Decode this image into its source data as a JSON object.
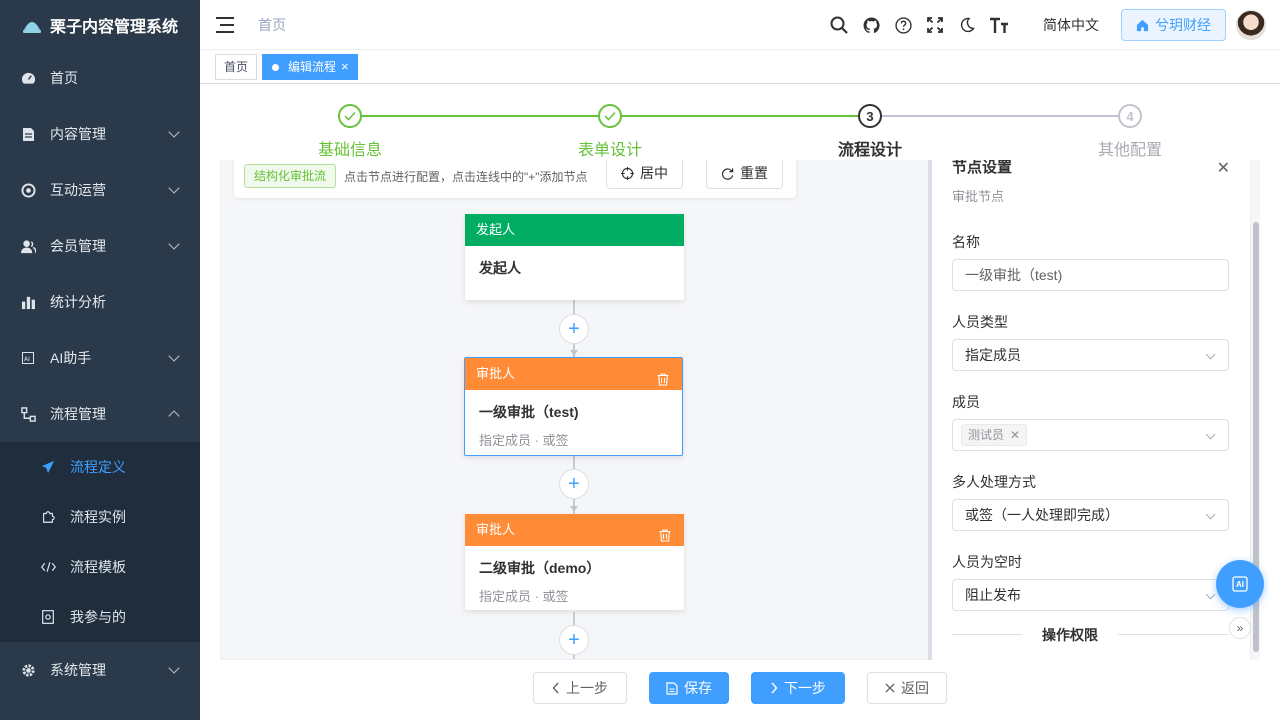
{
  "app": {
    "title": "栗子内容管理系统"
  },
  "sidebar": {
    "items": [
      {
        "label": "首页",
        "icon": "dashboard-icon"
      },
      {
        "label": "内容管理",
        "icon": "document-icon"
      },
      {
        "label": "互动运营",
        "icon": "target-icon"
      },
      {
        "label": "会员管理",
        "icon": "user-icon"
      },
      {
        "label": "统计分析",
        "icon": "bar-chart-icon"
      },
      {
        "label": "AI助手",
        "icon": "ai-icon"
      },
      {
        "label": "流程管理",
        "icon": "workflow-icon"
      },
      {
        "label": "系统管理",
        "icon": "gear-icon"
      }
    ],
    "subitems": [
      {
        "label": "流程定义",
        "icon": "paper-plane-icon"
      },
      {
        "label": "流程实例",
        "icon": "puzzle-icon"
      },
      {
        "label": "流程模板",
        "icon": "code-icon"
      },
      {
        "label": "我参与的",
        "icon": "clipboard-icon"
      }
    ]
  },
  "header": {
    "breadcrumb": "首页",
    "language": "简体中文",
    "user_name": "兮玥财经"
  },
  "tags": [
    {
      "label": "首页"
    },
    {
      "label": "编辑流程",
      "close": "×"
    }
  ],
  "steps": [
    {
      "label": "基础信息",
      "status": "done"
    },
    {
      "label": "表单设计",
      "status": "done"
    },
    {
      "label": "流程设计",
      "status": "active",
      "num": "3"
    },
    {
      "label": "其他配置",
      "status": "wait",
      "num": "4"
    }
  ],
  "toolbar": {
    "tag": "结构化审批流",
    "hint": "点击节点进行配置，点击连线中的\"+\"添加节点",
    "center_label": "居中",
    "reset_label": "重置"
  },
  "nodes": [
    {
      "type": "发起人",
      "title": "发起人",
      "sub": ""
    },
    {
      "type": "审批人",
      "title": "一级审批（test)",
      "sub": "指定成员 · 或签"
    },
    {
      "type": "审批人",
      "title": "二级审批（demo）",
      "sub": "指定成员 · 或签"
    }
  ],
  "panel": {
    "title": "节点设置",
    "subtitle": "审批节点",
    "name_label": "名称",
    "name_value": "一级审批（test)",
    "person_type_label": "人员类型",
    "person_type_value": "指定成员",
    "members_label": "成员",
    "member_chip": "测试员",
    "multi_label": "多人处理方式",
    "multi_value": "或签（一人处理即完成）",
    "empty_label": "人员为空时",
    "empty_value": "阻止发布",
    "perm_label": "操作权限"
  },
  "ai_fab": "AI",
  "footer": {
    "prev": "上一步",
    "save": "保存",
    "next": "下一步",
    "back": "返回"
  },
  "colors": {
    "primary": "#409eff",
    "success": "#67c23a",
    "starter": "#00ad63",
    "approver": "#ff8b36",
    "sidebar_bg": "#2b3a4a"
  }
}
